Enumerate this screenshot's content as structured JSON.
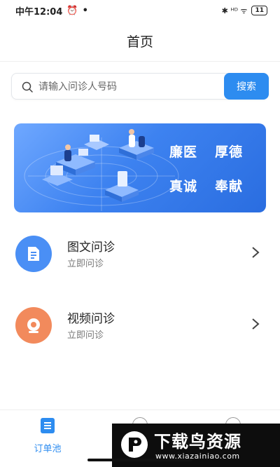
{
  "status_bar": {
    "time": "中午12:04",
    "alarm_glyph": "⏰",
    "dot_glyph": "•",
    "right_icons": "✱ ᴴᴰ ᯤ",
    "battery": "11"
  },
  "header": {
    "title": "首页"
  },
  "search": {
    "placeholder": "请输入问诊人号码",
    "button_label": "搜索"
  },
  "banner": {
    "words": [
      "廉医",
      "厚德",
      "真诚",
      "奉献"
    ]
  },
  "menu": [
    {
      "title": "图文问诊",
      "subtitle": "立即问诊",
      "icon": "document-icon",
      "color": "#4a8ff5"
    },
    {
      "title": "视频问诊",
      "subtitle": "立即问诊",
      "icon": "camera-icon",
      "color": "#f28a5c"
    }
  ],
  "bottom_nav": {
    "orders_label": "订单池"
  },
  "watermark": {
    "title": "下载鸟资源",
    "url": "www.xiazainiao.com"
  },
  "colors": {
    "accent": "#2d8cf0",
    "banner": "#3d82f0"
  }
}
